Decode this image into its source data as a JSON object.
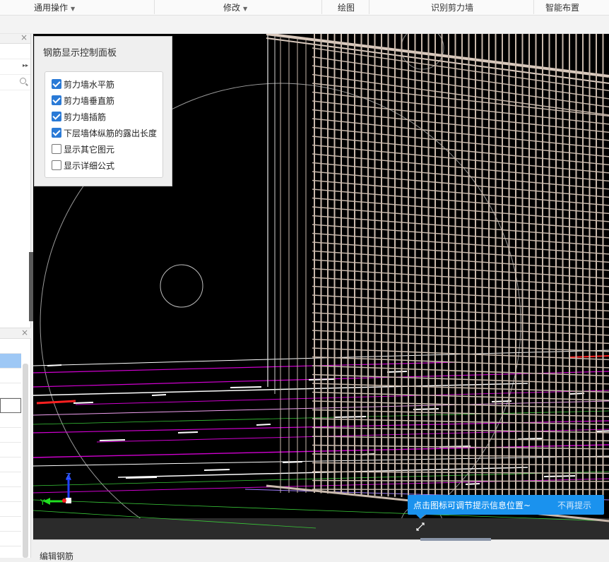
{
  "ribbon": {
    "groups": [
      "通用操作",
      "修改",
      "绘图",
      "识别剪力墙",
      "智能布置"
    ]
  },
  "left_panel": {
    "close_glyph": "×",
    "expand_glyph": "▸▸"
  },
  "control_panel": {
    "title": "钢筋显示控制面板",
    "options": [
      {
        "label": "剪力墙水平筋",
        "checked": true
      },
      {
        "label": "剪力墙垂直筋",
        "checked": true
      },
      {
        "label": "剪力墙插筋",
        "checked": true
      },
      {
        "label": "下层墙体纵筋的露出长度",
        "checked": true
      },
      {
        "label": "显示其它图元",
        "checked": false
      },
      {
        "label": "显示详细公式",
        "checked": false
      }
    ]
  },
  "axis": {
    "z": "Z",
    "y": "Y"
  },
  "tooltip": {
    "text": "点击图标可调节提示信息位置~",
    "dismiss": "不再提示"
  },
  "bottom": {
    "label": "编辑钢筋"
  },
  "colors": {
    "accent": "#1a92ee",
    "checkbox": "#2a7ad6",
    "rebar_grid": "#c9b9ac",
    "magenta_lines": "#d000d0"
  },
  "icons": [
    "search-icon",
    "close-icon",
    "expand-icon",
    "chevron-down-icon",
    "collapse-arrows-icon",
    "axis-gizmo-icon"
  ]
}
